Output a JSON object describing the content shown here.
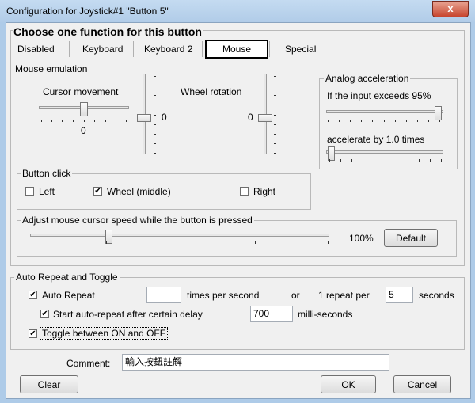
{
  "window": {
    "title": "Configuration for Joystick#1 \"Button 5\"",
    "close_glyph": "x"
  },
  "heading": "Choose one function for this button",
  "tabs": [
    "Disabled",
    "Keyboard",
    "Keyboard 2",
    "Mouse",
    "Special"
  ],
  "selected_tab": "Mouse",
  "mouse_emulation": {
    "legend": "Mouse emulation",
    "cursor_movement_label": "Cursor movement",
    "cursor_h_value": "0",
    "cursor_v_value": "0",
    "wheel_rotation_label": "Wheel rotation",
    "wheel_value": "0"
  },
  "analog": {
    "legend": "Analog acceleration",
    "threshold_label": "If the input exceeds 95%",
    "threshold_percent": 95,
    "accel_label": "accelerate by 1.0 times",
    "accel_value": 1.0
  },
  "button_click": {
    "legend": "Button click",
    "left_label": "Left",
    "left_checked": false,
    "wheel_label": "Wheel (middle)",
    "wheel_checked": true,
    "right_label": "Right",
    "right_checked": false
  },
  "speed": {
    "legend": "Adjust mouse cursor speed while the button is pressed",
    "value_text": "100%",
    "percent": 100,
    "default_label": "Default"
  },
  "auto_repeat": {
    "legend": "Auto Repeat and Toggle",
    "auto_repeat_label": "Auto Repeat",
    "auto_repeat_checked": true,
    "times_value": "",
    "times_label": "times per second",
    "or_label": "or",
    "repeat_label": "1 repeat per",
    "seconds_value": "5",
    "seconds_label": "seconds",
    "delay_label": "Start auto-repeat after certain delay",
    "delay_checked": true,
    "delay_value": "700",
    "delay_unit": "milli-seconds",
    "toggle_label": "Toggle between ON and OFF",
    "toggle_checked": true
  },
  "comment": {
    "label": "Comment:",
    "value": "輸入按鈕註解"
  },
  "buttons": {
    "clear": "Clear",
    "ok": "OK",
    "cancel": "Cancel"
  },
  "check_glyph": "✔"
}
